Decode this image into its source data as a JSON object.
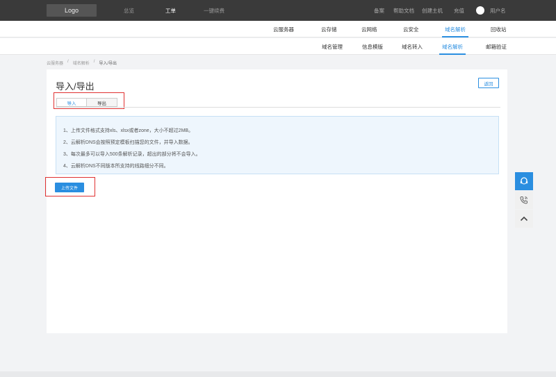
{
  "topbar": {
    "logo": "Logo",
    "nav": [
      "总览",
      "工单",
      "一键续费"
    ],
    "active_nav": "工单",
    "right": [
      "备案",
      "帮助文档",
      "创建主机",
      "充值"
    ],
    "username": "用户名"
  },
  "nav1": {
    "items": [
      "云服务器",
      "云存储",
      "云网络",
      "云安全",
      "域名解析",
      "回收站"
    ],
    "active": "域名解析"
  },
  "nav2": {
    "items": [
      "域名管理",
      "信息模版",
      "域名转入",
      "域名解析",
      "邮箱验证"
    ],
    "active": "域名解析"
  },
  "breadcrumb": [
    "云服务器",
    "域名解析",
    "导入/导出"
  ],
  "page": {
    "title": "导入/导出",
    "back_label": "返回",
    "tabs": [
      "导入",
      "导出"
    ],
    "active_tab": "导入",
    "notices": [
      "1、上传文件格式支持xls、xlsx或者zone，大小不超过2MB。",
      "2、云解析DNS会按照预定模板扫描您的文件，并导入数据。",
      "3、每次最多可以导入500条解析记录，超出的部分将不会导入。",
      "4、云解析DNS不同版本所支持的线路细分不同。"
    ],
    "upload_label": "上传文件"
  },
  "colors": {
    "accent": "#2a8ee0",
    "highlight": "#e03030",
    "topbar": "#3a3a3a"
  }
}
